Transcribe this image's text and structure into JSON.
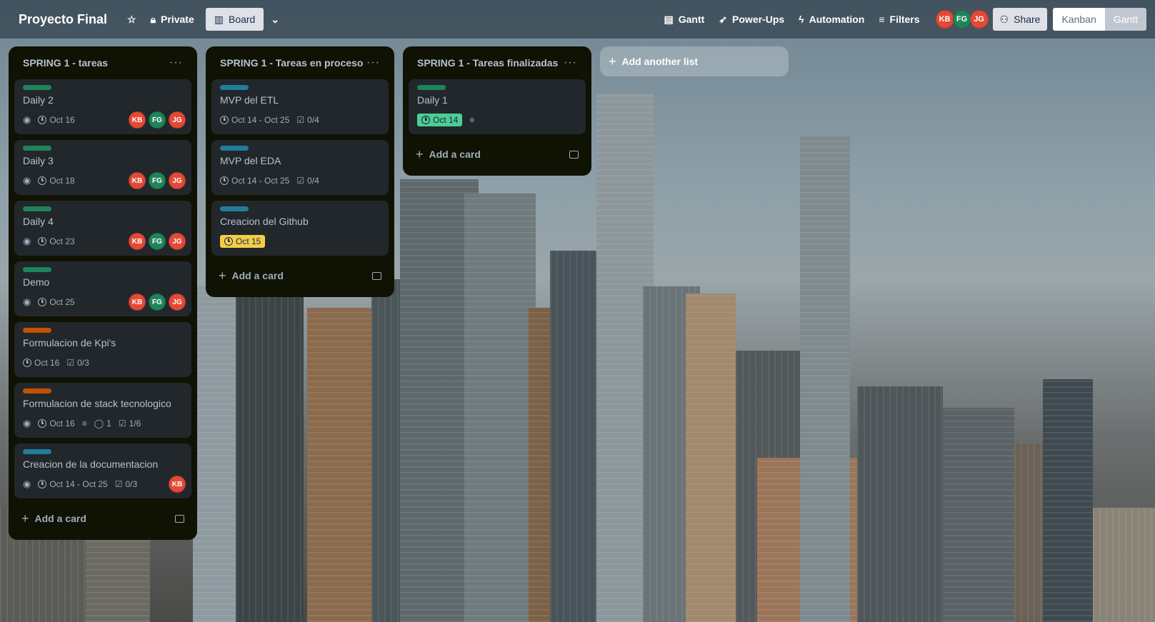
{
  "header": {
    "board_title": "Proyecto Final",
    "star_icon": "star-icon",
    "private_label": "Private",
    "board_view_label": "Board",
    "gantt_label": "Gantt",
    "powerups_label": "Power-Ups",
    "automation_label": "Automation",
    "filters_label": "Filters",
    "members": [
      "KB",
      "FG",
      "JG"
    ],
    "share_label": "Share",
    "kanban_label": "Kanban",
    "gantt_toggle_label": "Gantt"
  },
  "lists": [
    {
      "title": "SPRING 1 - tareas",
      "add_card": "Add a card",
      "cards": [
        {
          "title": "Daily 2",
          "label_color": "#1f845a",
          "watch": true,
          "due": "Oct 16",
          "members": [
            "KB",
            "FG",
            "JG"
          ]
        },
        {
          "title": "Daily 3",
          "label_color": "#1f845a",
          "watch": true,
          "due": "Oct 18",
          "members": [
            "KB",
            "FG",
            "JG"
          ]
        },
        {
          "title": "Daily 4",
          "label_color": "#1f845a",
          "watch": true,
          "due": "Oct 23",
          "members": [
            "KB",
            "FG",
            "JG"
          ]
        },
        {
          "title": "Demo",
          "label_color": "#1f845a",
          "watch": true,
          "due": "Oct 25",
          "members": [
            "KB",
            "FG",
            "JG"
          ]
        },
        {
          "title": "Formulacion de Kpi's",
          "label_color": "#c25100",
          "watch": false,
          "due": "Oct 16",
          "checklist": "0/3"
        },
        {
          "title": "Formulacion de stack tecnologico",
          "label_color": "#c25100",
          "watch": true,
          "due": "Oct 16",
          "description": true,
          "comments": "1",
          "checklist": "1/6"
        },
        {
          "title": "Creacion de la documentacion",
          "label_color": "#227d9b",
          "watch": true,
          "due": "Oct 14 - Oct 25",
          "checklist": "0/3",
          "members": [
            "KB"
          ]
        }
      ]
    },
    {
      "title": "SPRING 1 - Tareas en proceso",
      "add_card": "Add a card",
      "cards": [
        {
          "title": "MVP del ETL",
          "label_color": "#227d9b",
          "due": "Oct 14 - Oct 25",
          "checklist": "0/4"
        },
        {
          "title": "MVP del EDA",
          "label_color": "#227d9b",
          "due": "Oct 14 - Oct 25",
          "checklist": "0/4"
        },
        {
          "title": "Creacion del Github",
          "label_color": "#227d9b",
          "due": "Oct 15",
          "due_style": "yellow"
        }
      ]
    },
    {
      "title": "SPRING 1 - Tareas finalizadas",
      "add_card": "Add a card",
      "cards": [
        {
          "title": "Daily 1",
          "label_color": "#1f845a",
          "due": "Oct 14",
          "due_style": "green",
          "description": true
        }
      ]
    }
  ],
  "add_list_label": "Add another list"
}
